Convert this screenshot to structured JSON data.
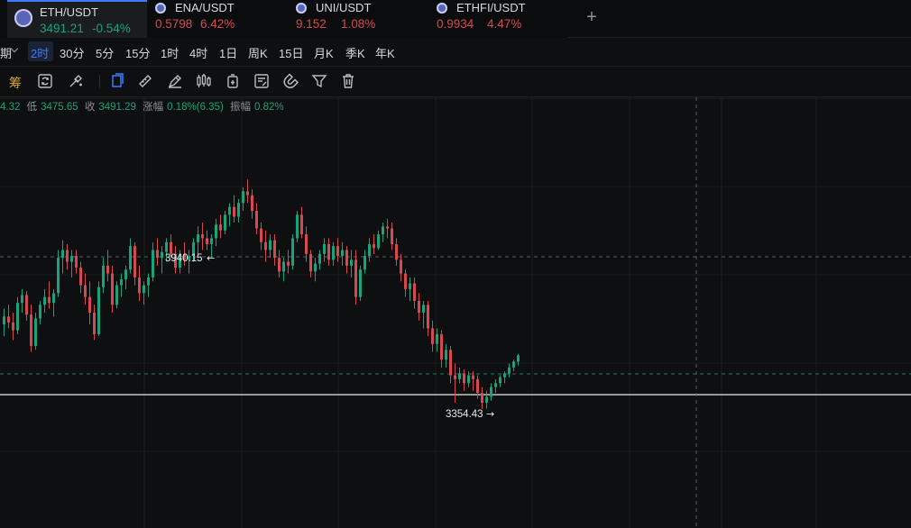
{
  "tickers": [
    {
      "symbol": "ETH/USDT",
      "price": "3491.21",
      "change": "-0.54%",
      "direction": "up",
      "active": true
    },
    {
      "symbol": "ENA/USDT",
      "price": "0.5798",
      "change": "6.42%",
      "direction": "down",
      "active": false
    },
    {
      "symbol": "UNI/USDT",
      "price": "9.152",
      "change": "1.08%",
      "direction": "down",
      "active": false
    },
    {
      "symbol": "ETHFI/USDT",
      "price": "0.9934",
      "change": "4.47%",
      "direction": "down",
      "active": false
    }
  ],
  "add_tab_label": "+",
  "timeframes": {
    "partial_label": "期",
    "items": [
      "2时",
      "30分",
      "5分",
      "15分",
      "1时",
      "4时",
      "1日",
      "周K",
      "15日",
      "月K",
      "季K",
      "年K"
    ],
    "active": "2时"
  },
  "toolbar": {
    "chip_label": "筹",
    "tools": [
      "sync-icon",
      "brush-clear-icon",
      "copy-icon",
      "ruler-icon",
      "pen-icon",
      "candles-icon",
      "tag-icon",
      "note-icon",
      "magnet-icon",
      "filter-icon",
      "trash-icon"
    ]
  },
  "ohlc": {
    "high_partial": "4.32",
    "low_label": "低",
    "low_value": "3475.65",
    "close_label": "收",
    "close_value": "3491.29",
    "change_label": "涨幅",
    "change_value": "0.18%(6.35)",
    "amplitude_label": "振幅",
    "amplitude_value": "0.82%"
  },
  "chart_data": {
    "type": "candlestick",
    "title": "",
    "annotations": {
      "high_label": "3940.15",
      "low_label": "3354.43"
    },
    "price_lines": [
      3940.15,
      3354.43,
      3491.21,
      3420
    ],
    "colors": {
      "up": "#1ba27a",
      "down": "#d64a4f",
      "grid": "#1a1c1f"
    },
    "ylim": [
      3050,
      4150
    ],
    "candles": [
      [
        3570,
        3610,
        3540,
        3590
      ],
      [
        3590,
        3620,
        3560,
        3575
      ],
      [
        3575,
        3600,
        3530,
        3555
      ],
      [
        3555,
        3640,
        3545,
        3625
      ],
      [
        3625,
        3660,
        3600,
        3645
      ],
      [
        3645,
        3655,
        3580,
        3595
      ],
      [
        3595,
        3620,
        3500,
        3515
      ],
      [
        3515,
        3600,
        3505,
        3585
      ],
      [
        3585,
        3630,
        3570,
        3620
      ],
      [
        3620,
        3660,
        3600,
        3640
      ],
      [
        3640,
        3680,
        3610,
        3625
      ],
      [
        3625,
        3660,
        3590,
        3650
      ],
      [
        3650,
        3760,
        3640,
        3740
      ],
      [
        3740,
        3785,
        3700,
        3760
      ],
      [
        3760,
        3775,
        3710,
        3730
      ],
      [
        3730,
        3760,
        3690,
        3745
      ],
      [
        3745,
        3760,
        3700,
        3715
      ],
      [
        3715,
        3730,
        3650,
        3670
      ],
      [
        3670,
        3700,
        3620,
        3640
      ],
      [
        3640,
        3680,
        3570,
        3600
      ],
      [
        3600,
        3620,
        3530,
        3545
      ],
      [
        3545,
        3680,
        3540,
        3665
      ],
      [
        3665,
        3740,
        3650,
        3720
      ],
      [
        3720,
        3760,
        3680,
        3700
      ],
      [
        3700,
        3720,
        3600,
        3620
      ],
      [
        3620,
        3680,
        3610,
        3670
      ],
      [
        3670,
        3700,
        3640,
        3685
      ],
      [
        3685,
        3720,
        3660,
        3710
      ],
      [
        3710,
        3790,
        3700,
        3770
      ],
      [
        3770,
        3780,
        3670,
        3690
      ],
      [
        3690,
        3720,
        3630,
        3650
      ],
      [
        3650,
        3680,
        3620,
        3670
      ],
      [
        3670,
        3700,
        3640,
        3690
      ],
      [
        3690,
        3780,
        3680,
        3760
      ],
      [
        3760,
        3790,
        3720,
        3740
      ],
      [
        3740,
        3770,
        3700,
        3755
      ],
      [
        3755,
        3790,
        3730,
        3780
      ],
      [
        3780,
        3800,
        3740,
        3750
      ],
      [
        3750,
        3770,
        3700,
        3715
      ],
      [
        3715,
        3760,
        3700,
        3750
      ],
      [
        3750,
        3780,
        3720,
        3735
      ],
      [
        3735,
        3760,
        3700,
        3745
      ],
      [
        3745,
        3790,
        3730,
        3780
      ],
      [
        3780,
        3820,
        3750,
        3800
      ],
      [
        3800,
        3830,
        3760,
        3790
      ],
      [
        3790,
        3810,
        3760,
        3775
      ],
      [
        3775,
        3800,
        3740,
        3790
      ],
      [
        3790,
        3840,
        3770,
        3825
      ],
      [
        3825,
        3850,
        3790,
        3810
      ],
      [
        3810,
        3860,
        3800,
        3850
      ],
      [
        3850,
        3880,
        3820,
        3870
      ],
      [
        3870,
        3900,
        3830,
        3845
      ],
      [
        3845,
        3890,
        3830,
        3880
      ],
      [
        3880,
        3920,
        3860,
        3910
      ],
      [
        3910,
        3940,
        3880,
        3900
      ],
      [
        3900,
        3915,
        3840,
        3860
      ],
      [
        3860,
        3880,
        3800,
        3815
      ],
      [
        3815,
        3830,
        3760,
        3780
      ],
      [
        3780,
        3810,
        3730,
        3760
      ],
      [
        3760,
        3800,
        3740,
        3785
      ],
      [
        3785,
        3800,
        3720,
        3740
      ],
      [
        3740,
        3760,
        3690,
        3705
      ],
      [
        3705,
        3740,
        3680,
        3730
      ],
      [
        3730,
        3760,
        3700,
        3720
      ],
      [
        3720,
        3800,
        3710,
        3790
      ],
      [
        3790,
        3860,
        3780,
        3850
      ],
      [
        3850,
        3870,
        3790,
        3800
      ],
      [
        3800,
        3820,
        3730,
        3750
      ],
      [
        3750,
        3760,
        3690,
        3705
      ],
      [
        3705,
        3740,
        3680,
        3725
      ],
      [
        3725,
        3760,
        3710,
        3750
      ],
      [
        3750,
        3790,
        3730,
        3775
      ],
      [
        3775,
        3790,
        3720,
        3735
      ],
      [
        3735,
        3780,
        3720,
        3770
      ],
      [
        3770,
        3790,
        3730,
        3745
      ],
      [
        3745,
        3780,
        3720,
        3760
      ],
      [
        3760,
        3770,
        3700,
        3720
      ],
      [
        3720,
        3760,
        3690,
        3735
      ],
      [
        3735,
        3760,
        3620,
        3640
      ],
      [
        3640,
        3720,
        3630,
        3710
      ],
      [
        3710,
        3760,
        3700,
        3745
      ],
      [
        3745,
        3790,
        3730,
        3775
      ],
      [
        3775,
        3800,
        3750,
        3765
      ],
      [
        3765,
        3810,
        3760,
        3800
      ],
      [
        3800,
        3830,
        3780,
        3820
      ],
      [
        3820,
        3840,
        3790,
        3815
      ],
      [
        3815,
        3830,
        3760,
        3775
      ],
      [
        3775,
        3790,
        3720,
        3735
      ],
      [
        3735,
        3750,
        3680,
        3700
      ],
      [
        3700,
        3710,
        3640,
        3660
      ],
      [
        3660,
        3690,
        3630,
        3675
      ],
      [
        3675,
        3690,
        3610,
        3630
      ],
      [
        3630,
        3650,
        3580,
        3600
      ],
      [
        3600,
        3630,
        3560,
        3620
      ],
      [
        3620,
        3630,
        3540,
        3560
      ],
      [
        3560,
        3580,
        3500,
        3520
      ],
      [
        3520,
        3560,
        3500,
        3545
      ],
      [
        3545,
        3555,
        3460,
        3480
      ],
      [
        3480,
        3520,
        3460,
        3505
      ],
      [
        3505,
        3515,
        3420,
        3440
      ],
      [
        3440,
        3470,
        3370,
        3430
      ],
      [
        3430,
        3460,
        3420,
        3445
      ],
      [
        3445,
        3455,
        3400,
        3420
      ],
      [
        3420,
        3450,
        3410,
        3440
      ],
      [
        3440,
        3450,
        3400,
        3430
      ],
      [
        3430,
        3440,
        3380,
        3395
      ],
      [
        3395,
        3410,
        3354,
        3370
      ],
      [
        3370,
        3400,
        3355,
        3385
      ],
      [
        3385,
        3420,
        3375,
        3410
      ],
      [
        3410,
        3430,
        3395,
        3420
      ],
      [
        3420,
        3440,
        3410,
        3435
      ],
      [
        3435,
        3450,
        3420,
        3445
      ],
      [
        3445,
        3470,
        3435,
        3460
      ],
      [
        3460,
        3480,
        3450,
        3475
      ],
      [
        3475,
        3495,
        3465,
        3491
      ]
    ]
  }
}
